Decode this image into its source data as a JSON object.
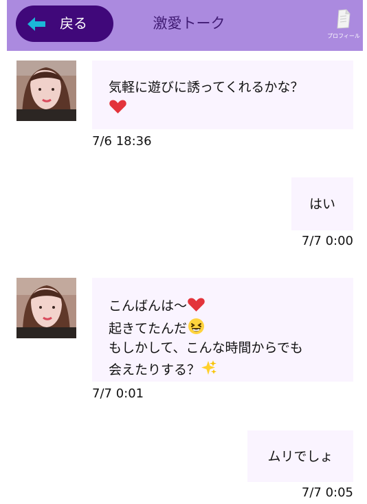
{
  "header": {
    "back_label": "戻る",
    "title": "激愛トーク",
    "profile_label": "プロフィール"
  },
  "messages": [
    {
      "direction": "incoming",
      "lines": [
        "気軽に遊びに誘ってくれるかな？"
      ],
      "emoji": [
        "heart-icon"
      ],
      "time": "7/6 18:36"
    },
    {
      "direction": "outgoing",
      "text": "はい",
      "time": "7/7 0:00"
    },
    {
      "direction": "incoming",
      "lines": [
        "こんばんは〜",
        "起きてたんだ",
        "もしかして、こんな時間からでも",
        "会えたりする？"
      ],
      "emoji": [
        "heart-icon",
        "laughing-face-icon",
        "sparkles-icon"
      ],
      "time": "7/7 0:01"
    },
    {
      "direction": "outgoing",
      "text": "ムリでしょ",
      "time": "7/7 0:05"
    }
  ],
  "colors": {
    "header_background": "#ab8adf",
    "back_button": "#40087a",
    "title_text": "#3f1a72",
    "bubble_background": "#faf4ff",
    "arrow": "#1bb8d8",
    "heart": "#e3343b"
  }
}
